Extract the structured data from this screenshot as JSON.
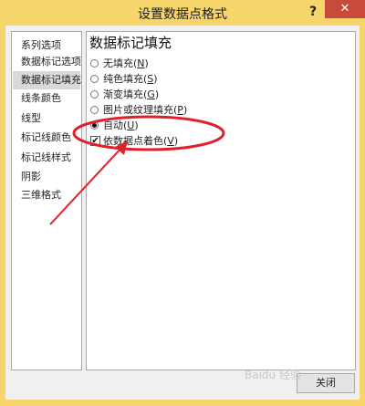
{
  "window": {
    "title": "设置数据点格式",
    "help_label": "?",
    "close_glyph": "✕"
  },
  "sidebar": {
    "items": [
      {
        "label": "系列选项"
      },
      {
        "label": "数据标记选项"
      },
      {
        "label": "数据标记填充"
      },
      {
        "label": "线条颜色"
      },
      {
        "label": "线型"
      },
      {
        "label": "标记线颜色"
      },
      {
        "label": "标记线样式"
      },
      {
        "label": "阴影"
      },
      {
        "label": "三维格式"
      }
    ],
    "selected_index": 2
  },
  "panel": {
    "title": "数据标记填充",
    "options": [
      {
        "label": "无填充",
        "hotkey": "N"
      },
      {
        "label": "纯色填充",
        "hotkey": "S"
      },
      {
        "label": "渐变填充",
        "hotkey": "G"
      },
      {
        "label": "图片或纹理填充",
        "hotkey": "P"
      },
      {
        "label": "自动",
        "hotkey": "U",
        "checked": true
      }
    ],
    "checkbox": {
      "label": "依数据点着色",
      "hotkey": "V",
      "checked": true,
      "mark": "✔"
    }
  },
  "footer": {
    "close_label": "关闭"
  },
  "watermark": "Baidu 经验",
  "colors": {
    "frame": "#f6d56a",
    "annotation": "#e0202a",
    "selected": "#d9d9d9"
  }
}
